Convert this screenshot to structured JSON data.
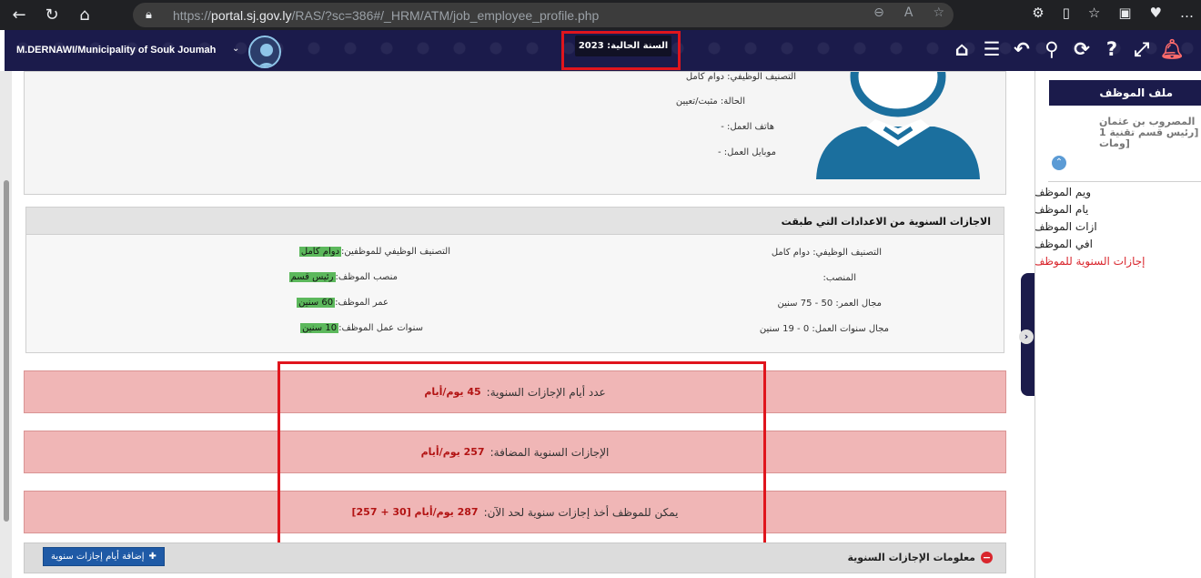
{
  "browser": {
    "url_prefix": "https://",
    "url_host": "portal.sj.gov.ly",
    "url_path": "/RAS/?sc=386#/_HRM/ATM/job_employee_profile.php"
  },
  "topbar": {
    "user_label": "M.DERNAWI/Municipality of Souk Joumah",
    "current_year": "السنة الحالية: 2023"
  },
  "profile": {
    "classification": "التصنيف الوظيفي: دوام كامل",
    "status": "الحالة: مثبت/تعيين",
    "work_phone": "هاتف العمل: -",
    "work_mobile": "موبايل العمل: -"
  },
  "rules": {
    "title": "الاجازات السنوية من الاعدادات التي طبقت",
    "left": [
      {
        "label": "التصنيف الوظيفي:",
        "value": "دوام كامل"
      },
      {
        "label": "المنصب:",
        "value": ""
      },
      {
        "label": "مجال العمر:",
        "value": "50 - 75 سنين"
      },
      {
        "label": "مجال سنوات العمل:",
        "value": "0 - 19 سنين"
      }
    ],
    "right": [
      {
        "label": "التصنيف الوظيفي للموظفين:",
        "value": "دوام كامل"
      },
      {
        "label": "منصب الموظف:",
        "value": "رئيس قسم"
      },
      {
        "label": "عمر الموظف:",
        "value": "60 سنين"
      },
      {
        "label": "سنوات عمل الموظف:",
        "value": "10 سنين"
      }
    ]
  },
  "summary": [
    {
      "label": "عدد أيام الإجازات السنوية:",
      "value": "45 يوم/أيام"
    },
    {
      "label": "الإجازات السنوية المضافة:",
      "value": "257 يوم/أيام"
    },
    {
      "label": "يمكن للموظف أخذ إجازات سنوية لحد الآن:",
      "value": "287 يوم/أيام [30 + 257]"
    }
  ],
  "info_section": {
    "title": "معلومات الإجازات السنوية",
    "add_button": "إضافة أيام إجازات سنوية"
  },
  "sidebar": {
    "header": "ملف الموظف",
    "name_lines": [
      "المصروب بن عثمان",
      "[رئيس قسم تقنية 1",
      "[ومات"
    ],
    "items": [
      {
        "label": "ويم الموظف",
        "active": false
      },
      {
        "label": "يام الموظف",
        "active": false
      },
      {
        "label": "ازات الموظف",
        "active": false
      },
      {
        "label": "افي الموظف",
        "active": false
      },
      {
        "label": "إجازات السنوية للموظف",
        "active": true
      }
    ]
  },
  "colors": {
    "brand_navy": "#1b1b4b",
    "highlight_red": "#e0151d",
    "summary_pink": "#f0b6b6",
    "value_red": "#b31414",
    "badge_green": "#5cb85c"
  }
}
